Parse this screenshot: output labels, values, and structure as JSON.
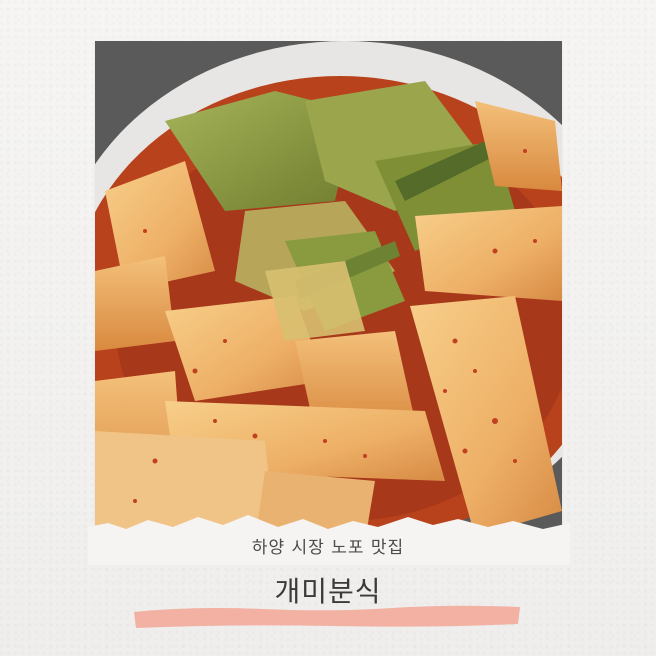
{
  "image": {
    "subject": "kimchi-and-rice-cake-stew-photo",
    "accent_colors": {
      "broth": "#b8421c",
      "rice_cake": "#efb56c",
      "cabbage": "#8da04a",
      "underline": "#f2b1a3"
    }
  },
  "caption": {
    "subtitle": "하양 시장 노포 맛집",
    "title": "개미분식"
  }
}
